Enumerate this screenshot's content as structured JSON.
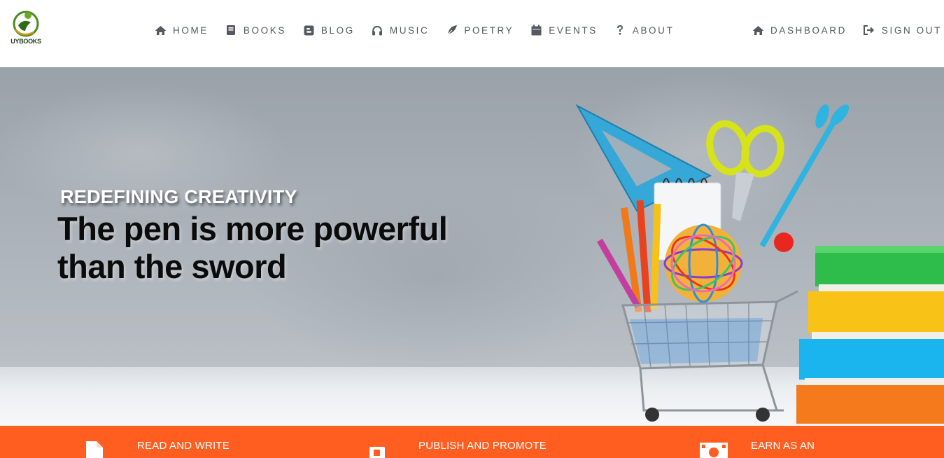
{
  "brand": {
    "logo_text": "UYBOOKS"
  },
  "nav": {
    "main": [
      {
        "label": "HOME",
        "icon": "home-icon"
      },
      {
        "label": "BOOKS",
        "icon": "book-icon"
      },
      {
        "label": "BLOG",
        "icon": "blogger-icon"
      },
      {
        "label": "MUSIC",
        "icon": "headphones-icon"
      },
      {
        "label": "POETRY",
        "icon": "feather-icon"
      },
      {
        "label": "EVENTS",
        "icon": "calendar-icon"
      },
      {
        "label": "ABOUT",
        "icon": "question-icon"
      }
    ],
    "right": [
      {
        "label": "DASHBOARD",
        "icon": "home-icon"
      },
      {
        "label": "SIGN OUT",
        "icon": "sign-out-icon"
      }
    ]
  },
  "hero": {
    "eyebrow": "REDEFINING CREATIVITY",
    "title_line1": "The pen is more powerful",
    "title_line2": "than the sword"
  },
  "features": [
    {
      "title": "READ AND WRITE",
      "icon": "file-icon"
    },
    {
      "title": "PUBLISH AND PROMOTE",
      "icon": "document-icon"
    },
    {
      "title": "EARN AS AN",
      "icon": "money-icon"
    }
  ],
  "colors": {
    "accent": "#ff5e20",
    "nav_text": "#555a60",
    "logo_green": "#4a8c1c"
  }
}
